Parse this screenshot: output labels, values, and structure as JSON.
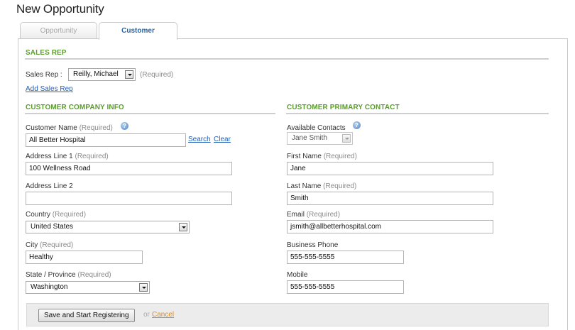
{
  "page": {
    "title": "New Opportunity"
  },
  "tabs": [
    {
      "label": "Opportunity",
      "active": false
    },
    {
      "label": "Customer",
      "active": true
    }
  ],
  "sales_rep": {
    "section_title": "SALES REP",
    "label": "Sales Rep :",
    "selected": "Reilly, Michael",
    "required": "(Required)",
    "add_link": "Add Sales Rep"
  },
  "company": {
    "section_title": "CUSTOMER COMPANY INFO",
    "customer_name": {
      "label": "Customer Name",
      "required": "(Required)",
      "value": "All Better Hospital"
    },
    "search_link": "Search",
    "clear_link": "Clear",
    "address1": {
      "label": "Address Line 1",
      "required": "(Required)",
      "value": "100 Wellness Road"
    },
    "address2": {
      "label": "Address Line 2",
      "value": ""
    },
    "country": {
      "label": "Country",
      "required": "(Required)",
      "value": "United States"
    },
    "city": {
      "label": "City",
      "required": "(Required)",
      "value": "Healthy"
    },
    "state": {
      "label": "State / Province",
      "required": "(Required)",
      "value": "Washington"
    }
  },
  "contact": {
    "section_title": "CUSTOMER PRIMARY CONTACT",
    "available": {
      "label": "Available Contacts",
      "value": "Jane Smith"
    },
    "first_name": {
      "label": "First Name",
      "required": "(Required)",
      "value": "Jane"
    },
    "last_name": {
      "label": "Last Name",
      "required": "(Required)",
      "value": "Smith"
    },
    "email": {
      "label": "Email",
      "required": "(Required)",
      "value": "jsmith@allbetterhospital.com"
    },
    "business_phone": {
      "label": "Business Phone",
      "value": "555-555-5555"
    },
    "mobile": {
      "label": "Mobile",
      "value": "555-555-5555"
    }
  },
  "footer": {
    "save_label": "Save and Start Registering",
    "or_text": "or",
    "cancel_label": "Cancel"
  },
  "icons": {
    "help": "help-icon",
    "dropdown": "chevron-down-icon"
  },
  "colors": {
    "section_heading": "#5a9e2a",
    "link": "#1f5fb5",
    "cancel": "#e08a1e",
    "active_tab": "#2266aa"
  }
}
